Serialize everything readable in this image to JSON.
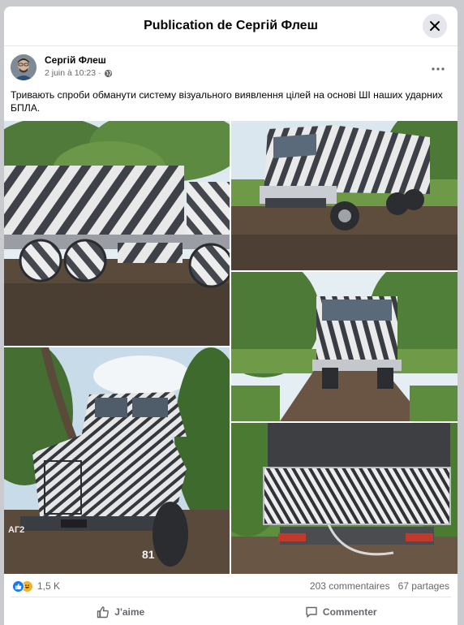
{
  "modal": {
    "title": "Publication de Сергій Флеш"
  },
  "post": {
    "author": "Сергій Флеш",
    "date": "2 juin à 10:23",
    "separator": "·",
    "text": "Тривають спроби обманути систему візуального виявлення цілей на основі ШІ наших ударних БПЛА."
  },
  "photos": [
    {
      "name": "photo-truck-side-zebra"
    },
    {
      "name": "photo-truck-front-angle"
    },
    {
      "name": "photo-truck-front-road"
    },
    {
      "name": "photo-truck-ural-front"
    },
    {
      "name": "photo-truck-rear-panel"
    }
  ],
  "photo_labels": {
    "plate": "АГ2",
    "number": "81"
  },
  "footer": {
    "reaction_count": "1,5 K",
    "comments": "203 commentaires",
    "shares": "67 partages",
    "like_label": "J'aime",
    "comment_label": "Commenter"
  },
  "icons": {
    "close": "close-icon",
    "more": "more-icon",
    "globe": "globe-icon",
    "like": "thumbs-up-icon",
    "comment": "comment-icon"
  },
  "colors": {
    "link_blue": "#1877f2",
    "text_gray": "#65676b",
    "haha_yellow": "#f7b125"
  }
}
